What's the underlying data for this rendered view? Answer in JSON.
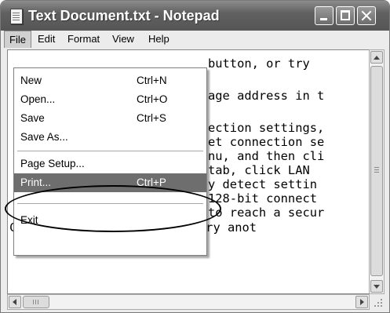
{
  "window": {
    "title": "Text Document.txt - Notepad",
    "app_icon": "notepad-icon",
    "controls": {
      "minimize": "minimize-icon",
      "maximize": "maximize-icon",
      "close": "close-icon"
    }
  },
  "menubar": {
    "items": [
      "File",
      "Edit",
      "Format",
      "View",
      "Help"
    ],
    "active": "File"
  },
  "file_menu": {
    "items": [
      {
        "label": "New",
        "shortcut": "Ctrl+N"
      },
      {
        "label": "Open...",
        "shortcut": "Ctrl+O"
      },
      {
        "label": "Save",
        "shortcut": "Ctrl+S"
      },
      {
        "label": "Save As...",
        "shortcut": ""
      },
      {
        "label": "Page Setup...",
        "shortcut": ""
      },
      {
        "label": "Print...",
        "shortcut": "Ctrl+P"
      },
      {
        "label": "Exit",
        "shortcut": ""
      }
    ],
    "highlighted": "Print..."
  },
  "document": {
    "lines": [
      "button, or try",
      "age address in t",
      "ection settings,",
      "et connection se",
      "nu, and then cli",
      "tab, click LAN",
      "y detect settin",
      "128-bit connect",
      "to reach a secur",
      "Click the  Back button to try anot"
    ]
  },
  "scrollbars": {
    "vertical": {
      "up": "scroll-up-arrow-icon",
      "down": "scroll-down-arrow-icon"
    },
    "horizontal": {
      "left": "scroll-left-arrow-icon",
      "right": "scroll-right-arrow-icon"
    }
  },
  "annotation": {
    "shape": "ellipse",
    "target": "Print..."
  }
}
